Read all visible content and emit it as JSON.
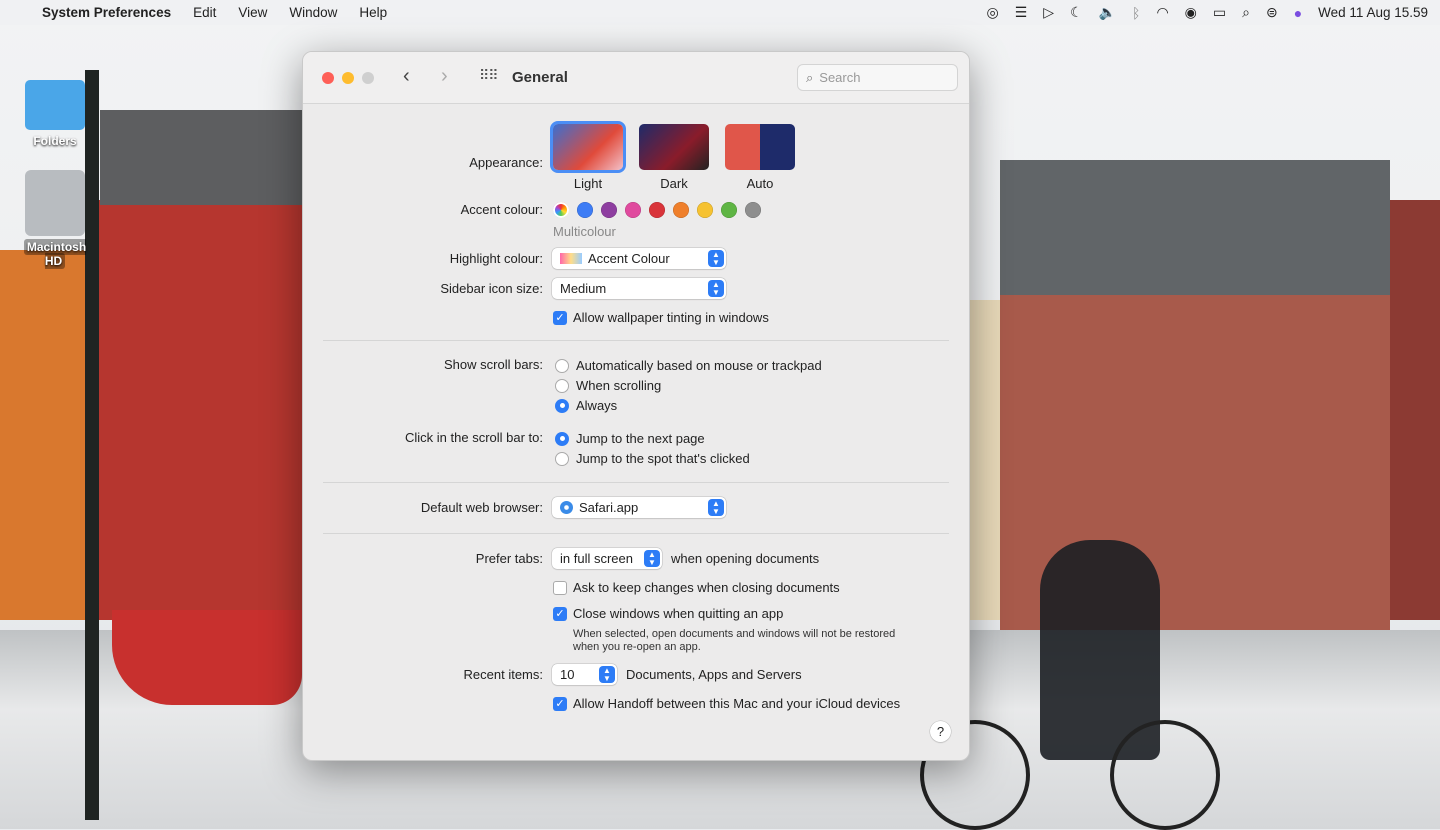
{
  "menubar": {
    "app": "System Preferences",
    "menus": [
      "Edit",
      "View",
      "Window",
      "Help"
    ],
    "clock": "Wed 11 Aug  15.59"
  },
  "desktop": {
    "icons": [
      "Folders",
      "Macintosh HD"
    ]
  },
  "window": {
    "title": "General",
    "search_placeholder": "Search",
    "appearance": {
      "label": "Appearance:",
      "options": [
        "Light",
        "Dark",
        "Auto"
      ],
      "selected": "Light"
    },
    "accent": {
      "label": "Accent colour:",
      "selected_name": "Multicolour",
      "colors": [
        "#3d7cf5",
        "#8e3ea0",
        "#e04a9e",
        "#d9343a",
        "#ef7f2b",
        "#f6c231",
        "#5fb544",
        "#8e8e8e"
      ]
    },
    "highlight": {
      "label": "Highlight colour:",
      "value": "Accent Colour"
    },
    "sidebar_size": {
      "label": "Sidebar icon size:",
      "value": "Medium"
    },
    "tinting": {
      "label": "Allow wallpaper tinting in windows",
      "checked": true
    },
    "scrollbars": {
      "label": "Show scroll bars:",
      "options": [
        "Automatically based on mouse or trackpad",
        "When scrolling",
        "Always"
      ],
      "selected": 2
    },
    "click_scroll": {
      "label": "Click in the scroll bar to:",
      "options": [
        "Jump to the next page",
        "Jump to the spot that's clicked"
      ],
      "selected": 0
    },
    "browser": {
      "label": "Default web browser:",
      "value": "Safari.app"
    },
    "tabs": {
      "label": "Prefer tabs:",
      "value": "in full screen",
      "suffix": "when opening documents"
    },
    "ask_keep": {
      "label": "Ask to keep changes when closing documents",
      "checked": false
    },
    "close_windows": {
      "label": "Close windows when quitting an app",
      "checked": true,
      "note1": "When selected, open documents and windows will not be restored",
      "note2": "when you re-open an app."
    },
    "recent": {
      "label": "Recent items:",
      "value": "10",
      "suffix": "Documents, Apps and Servers"
    },
    "handoff": {
      "label": "Allow Handoff between this Mac and your iCloud devices",
      "checked": true
    },
    "help": "?"
  }
}
